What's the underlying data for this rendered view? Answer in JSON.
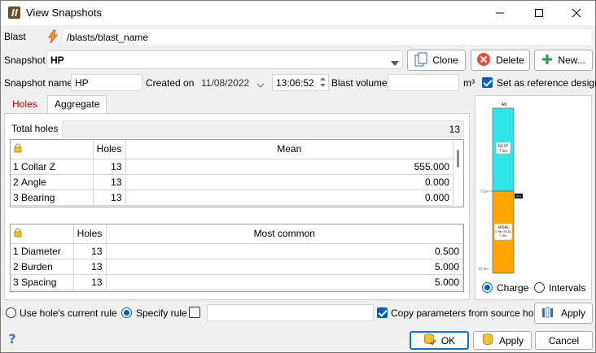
{
  "window": {
    "title": "View Snapshots"
  },
  "blast": {
    "label": "Blast",
    "value": "/blasts/blast_name"
  },
  "snapshot": {
    "label": "Snapshot",
    "value": "HP",
    "clone_label": "Clone",
    "delete_label": "Delete",
    "new_label": "New..."
  },
  "details": {
    "name_label": "Snapshot name",
    "name_value": "HP",
    "created_label": "Created on",
    "date_value": "11/08/2022",
    "time_value": "13:06:52",
    "volume_label": "Blast volume",
    "volume_value": "",
    "volume_unit": "m³",
    "reference_label": "Set as reference design"
  },
  "tabs": [
    {
      "label": "Holes"
    },
    {
      "label": "Aggregate"
    }
  ],
  "aggregate": {
    "total_label": "Total holes",
    "total_value": "13",
    "mean_table": {
      "headers": [
        "Holes",
        "Mean"
      ],
      "rows": [
        {
          "idx": "1",
          "name": "Collar Z",
          "holes": "13",
          "value": "555.000"
        },
        {
          "idx": "2",
          "name": "Angle",
          "holes": "13",
          "value": "0.000"
        },
        {
          "idx": "3",
          "name": "Bearing",
          "holes": "13",
          "value": "0.000"
        }
      ]
    },
    "common_table": {
      "headers": [
        "Holes",
        "Most common"
      ],
      "rows": [
        {
          "idx": "1",
          "name": "Diameter",
          "holes": "13",
          "value": "0.500"
        },
        {
          "idx": "2",
          "name": "Burden",
          "holes": "13",
          "value": "5.000"
        },
        {
          "idx": "3",
          "name": "Spacing",
          "holes": "13",
          "value": "5.000"
        }
      ]
    }
  },
  "charge_diagram": {
    "top_label": "A0",
    "stemming_name": "DJCUT",
    "stemming_len": "7.5m",
    "mid_tick": "7.5m",
    "side_label": "5m",
    "charge_name": "APDBS",
    "charge_sub": "0.96 (OCD)",
    "charge_len": "7.5m",
    "bottom_tick": "15.0m",
    "colors": {
      "stemming": "#2ee6e6",
      "charge": "#ffa500"
    }
  },
  "view_mode": {
    "charge_label": "Charge",
    "intervals_label": "Intervals"
  },
  "rule": {
    "current_label": "Use hole's current rule",
    "specify_label": "Specify rule",
    "rule_value": "",
    "copy_label": "Copy parameters from source hole",
    "apply_label": "Apply"
  },
  "footer": {
    "ok_label": "OK",
    "apply_label": "Apply",
    "cancel_label": "Cancel"
  }
}
